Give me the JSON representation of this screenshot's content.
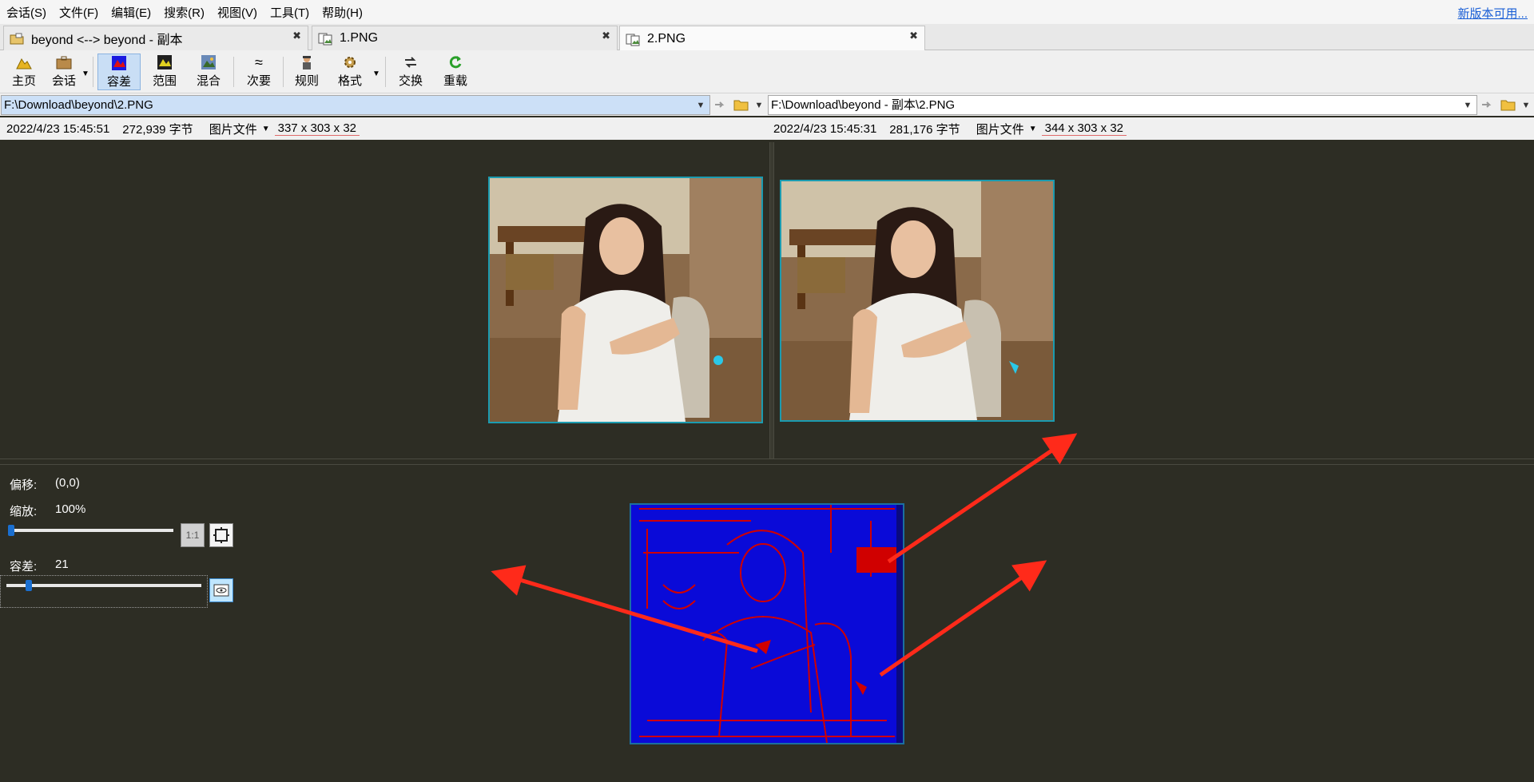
{
  "menu": {
    "items": [
      "会话(S)",
      "文件(F)",
      "编辑(E)",
      "搜索(R)",
      "视图(V)",
      "工具(T)",
      "帮助(H)"
    ],
    "update_link": "新版本可用..."
  },
  "tabs": [
    {
      "label": "beyond <--> beyond - 副本",
      "icon": "session-folder-icon",
      "active": false
    },
    {
      "label": "1.PNG",
      "icon": "picture-compare-icon",
      "active": false
    },
    {
      "label": "2.PNG",
      "icon": "picture-compare-icon",
      "active": true
    }
  ],
  "toolbar": {
    "home": "主页",
    "session": "会话",
    "tolerance": "容差",
    "range": "范围",
    "blend": "混合",
    "minor": "次要",
    "rules": "规则",
    "format": "格式",
    "swap": "交换",
    "reload": "重载"
  },
  "left": {
    "path": "F:\\Download\\beyond\\2.PNG",
    "date": "2022/4/23 15:45:51",
    "size": "272,939 字节",
    "type": "图片文件",
    "dims": "337 x 303 x 32"
  },
  "right": {
    "path": "F:\\Download\\beyond - 副本\\2.PNG",
    "date": "2022/4/23 15:45:31",
    "size": "281,176 字节",
    "type": "图片文件",
    "dims": "344 x 303 x 32"
  },
  "controls": {
    "offset_label": "偏移:",
    "offset_value": "(0,0)",
    "zoom_label": "缩放:",
    "zoom_value": "100%",
    "zoom_level": 0.0,
    "tolerance_label": "容差:",
    "tolerance_value": "21",
    "tolerance_level": 0.1
  },
  "colors": {
    "accent": "#1b9bb0",
    "diff_blue": "#0a0ad8",
    "diff_red": "#d00000",
    "arrow": "#ff2a1a",
    "background": "#2d2d24"
  }
}
